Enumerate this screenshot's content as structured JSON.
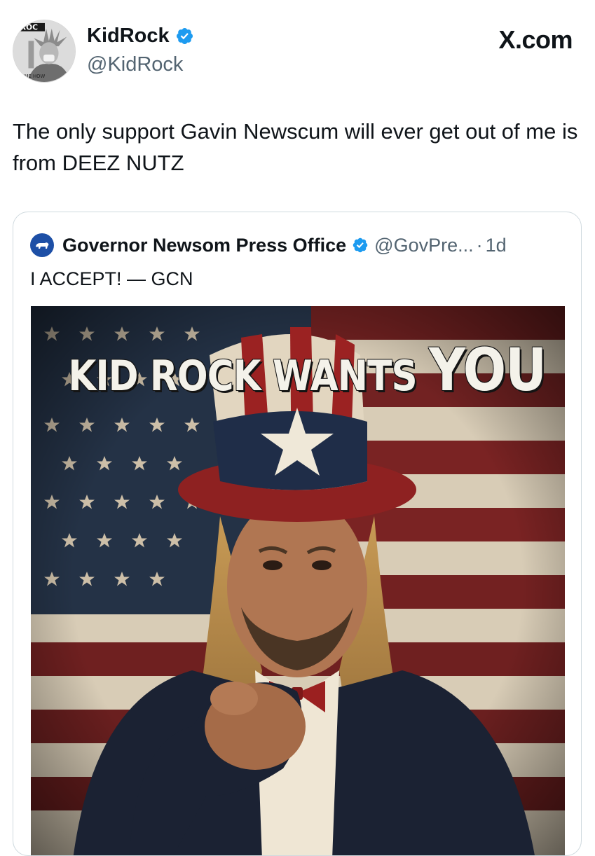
{
  "tweet": {
    "display_name": "KidRock",
    "handle": "@KidRock",
    "text": "The only support Gavin Newscum will ever get out of me is from DEEZ NUTZ",
    "brand": "X.com",
    "avatar_icon": "kidrock-statue-of-liberty-avatar",
    "verified_icon": "verified-badge-icon"
  },
  "quote": {
    "display_name": "Governor Newsom Press Office",
    "handle": "@GovPre...",
    "separator": "·",
    "time": "1d",
    "text": "I ACCEPT! — GCN",
    "avatar_icon": "california-bear-avatar",
    "image": {
      "poster_text": "KID ROCK WANTS",
      "poster_text_big": "YOU",
      "description_icon": "uncle-sam-style-poster"
    }
  },
  "colors": {
    "verified": "#1d9bf0",
    "secondary_text": "#536471",
    "border": "#cfd9de",
    "flag_red": "#7a2323",
    "flag_blue": "#243246"
  }
}
